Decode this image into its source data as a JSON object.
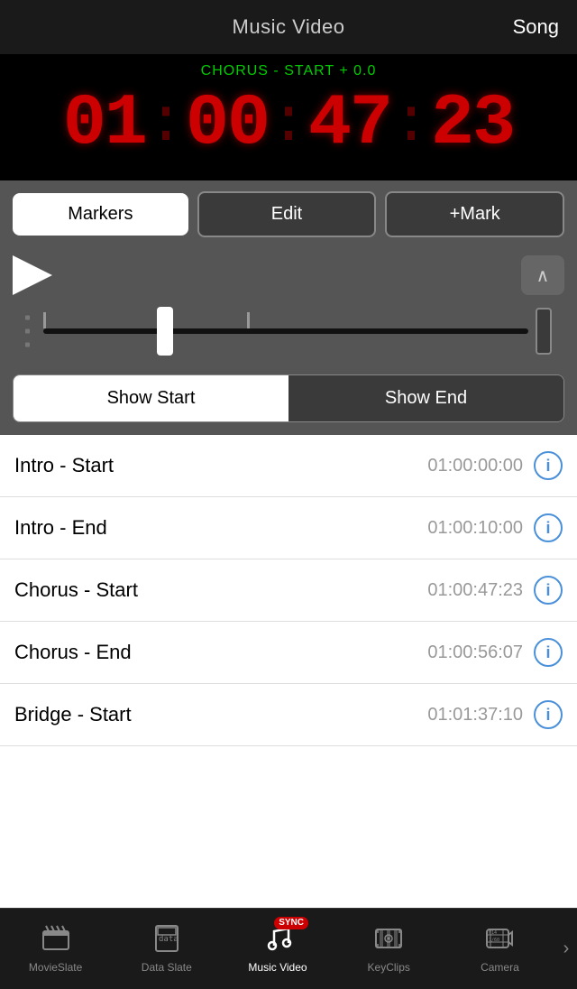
{
  "header": {
    "title": "Music Video",
    "right_label": "Song"
  },
  "timecode": {
    "label": "CHORUS - START + 0.0",
    "display": "01:00:47:23",
    "parts": [
      "01",
      "00",
      "47",
      "23"
    ]
  },
  "controls": {
    "markers_label": "Markers",
    "edit_label": "Edit",
    "mark_label": "+Mark"
  },
  "playback": {
    "collapse_icon": "∧"
  },
  "toggle": {
    "show_start_label": "Show Start",
    "show_end_label": "Show End"
  },
  "markers": [
    {
      "name": "Intro - Start",
      "time": "01:00:00:00"
    },
    {
      "name": "Intro - End",
      "time": "01:00:10:00"
    },
    {
      "name": "Chorus - Start",
      "time": "01:00:47:23"
    },
    {
      "name": "Chorus - End",
      "time": "01:00:56:07"
    },
    {
      "name": "Bridge - Start",
      "time": "01:01:37:10"
    }
  ],
  "info_button_label": "i",
  "bottom_nav": {
    "items": [
      {
        "id": "movieslate",
        "label": "MovieSlate",
        "icon": "🎬"
      },
      {
        "id": "dataslate",
        "label": "Data Slate",
        "icon": "📋"
      },
      {
        "id": "musicvideo",
        "label": "Music Video",
        "icon": "♪",
        "active": true,
        "sync": "SYNC"
      },
      {
        "id": "keyclips",
        "label": "KeyClips",
        "icon": "🎞"
      },
      {
        "id": "camera",
        "label": "Camera",
        "icon": "📷",
        "sub": "F14\n1/60"
      }
    ],
    "arrow": "›"
  }
}
